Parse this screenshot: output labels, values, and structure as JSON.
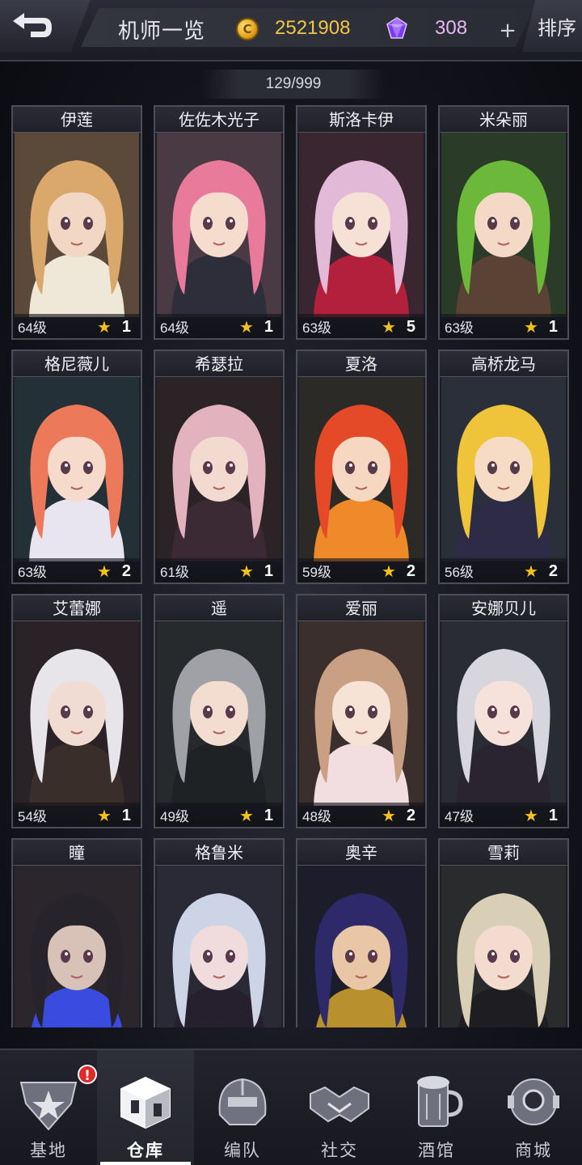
{
  "header": {
    "title": "机师一览",
    "coins": "2521908",
    "gems": "308",
    "sort_label": "排序",
    "plus_label": "+",
    "coin_symbol": "C",
    "count": "129/999"
  },
  "pilots": [
    {
      "name": "伊莲",
      "level": "64级",
      "stars": "1",
      "hair": "#d9a86a",
      "skin": "#f2d8c4",
      "bg": "#5b4a3a",
      "outfit": "#efe7d8"
    },
    {
      "name": "佐佐木光子",
      "level": "64级",
      "stars": "1",
      "hair": "#e87a9c",
      "skin": "#f6dccd",
      "bg": "#4a3a44",
      "outfit": "#2e2d3a"
    },
    {
      "name": "斯洛卡伊",
      "level": "63级",
      "stars": "5",
      "hair": "#e2b9d6",
      "skin": "#f7e0d6",
      "bg": "#3a2630",
      "outfit": "#b3203c"
    },
    {
      "name": "米朵丽",
      "level": "63级",
      "stars": "1",
      "hair": "#6bb83a",
      "skin": "#f4d9c6",
      "bg": "#2a3b28",
      "outfit": "#5a4334"
    },
    {
      "name": "格尼薇儿",
      "level": "63级",
      "stars": "2",
      "hair": "#ec7a5a",
      "skin": "#f6dacb",
      "bg": "#243038",
      "outfit": "#e9e5f0"
    },
    {
      "name": "希瑟拉",
      "level": "61级",
      "stars": "1",
      "hair": "#e3b2bf",
      "skin": "#f3dad0",
      "bg": "#2c2327",
      "outfit": "#3b2a33"
    },
    {
      "name": "夏洛",
      "level": "59级",
      "stars": "2",
      "hair": "#e44a28",
      "skin": "#f6d7c2",
      "bg": "#2c2a26",
      "outfit": "#ee8a2a"
    },
    {
      "name": "高桥龙马",
      "level": "56级",
      "stars": "2",
      "hair": "#f0c43a",
      "skin": "#f6dcc5",
      "bg": "#2a2f3a",
      "outfit": "#2d2b45"
    },
    {
      "name": "艾蕾娜",
      "level": "54级",
      "stars": "1",
      "hair": "#e7e5ea",
      "skin": "#f1dcd4",
      "bg": "#2a2226",
      "outfit": "#3a2e2a"
    },
    {
      "name": "遥",
      "level": "49级",
      "stars": "1",
      "hair": "#9fa1a6",
      "skin": "#f3ddd0",
      "bg": "#262a2c",
      "outfit": "#1e2224"
    },
    {
      "name": "爱丽",
      "level": "48级",
      "stars": "2",
      "hair": "#caa084",
      "skin": "#f7e2d6",
      "bg": "#3a2f2c",
      "outfit": "#f2dee0"
    },
    {
      "name": "安娜贝儿",
      "level": "47级",
      "stars": "1",
      "hair": "#d7d6dc",
      "skin": "#f6e2da",
      "bg": "#2a2c34",
      "outfit": "#2a2430"
    },
    {
      "name": "瞳",
      "level": "",
      "stars": "",
      "hair": "#26232b",
      "skin": "#d8c2b8",
      "bg": "#2b262c",
      "outfit": "#3a4be0"
    },
    {
      "name": "格鲁米",
      "level": "",
      "stars": "",
      "hair": "#cdd4e6",
      "skin": "#f0dcdc",
      "bg": "#2a2a36",
      "outfit": "#26202e"
    },
    {
      "name": "奥辛",
      "level": "",
      "stars": "",
      "hair": "#2e2a6a",
      "skin": "#e8c6a6",
      "bg": "#1d1c2a",
      "outfit": "#b8902e"
    },
    {
      "name": "雪莉",
      "level": "",
      "stars": "",
      "hair": "#d9cfb6",
      "skin": "#f3dccd",
      "bg": "#2a2b2c",
      "outfit": "#1e1e22"
    }
  ],
  "nav": [
    {
      "label": "基地",
      "icon": "base-emblem-icon",
      "active": false,
      "alert": "!"
    },
    {
      "label": "仓库",
      "icon": "warehouse-cube-icon",
      "active": true,
      "alert": ""
    },
    {
      "label": "编队",
      "icon": "mech-helmet-icon",
      "active": false,
      "alert": ""
    },
    {
      "label": "社交",
      "icon": "handshake-icon",
      "active": false,
      "alert": ""
    },
    {
      "label": "酒馆",
      "icon": "beer-mug-icon",
      "active": false,
      "alert": ""
    },
    {
      "label": "商城",
      "icon": "robot-head-icon",
      "active": false,
      "alert": ""
    }
  ],
  "colors": {
    "coin": "#f2c54a",
    "gem": "#e7b8f1",
    "star": "#f3c21a",
    "alert": "#e02a2a"
  }
}
